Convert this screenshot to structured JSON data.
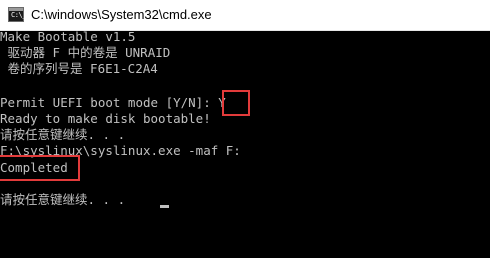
{
  "window": {
    "title": "C:\\windows\\System32\\cmd.exe",
    "icon_prompt": "C:\\_"
  },
  "console": {
    "lines": [
      "Make Bootable v1.5",
      " 驱动器 F 中的卷是 UNRAID",
      " 卷的序列号是 F6E1-C2A4",
      "",
      "Permit UEFI boot mode [Y/N]: Y",
      "Ready to make disk bootable!",
      "请按任意键继续. . .",
      "F:\\syslinux\\syslinux.exe -maf F:",
      "Completed",
      "",
      "请按任意键继续. . ."
    ]
  },
  "colors": {
    "console_background": "#000000",
    "console_text": "#c0c0c0",
    "highlight_border": "#e23b3b",
    "titlebar_background": "#ffffff"
  }
}
